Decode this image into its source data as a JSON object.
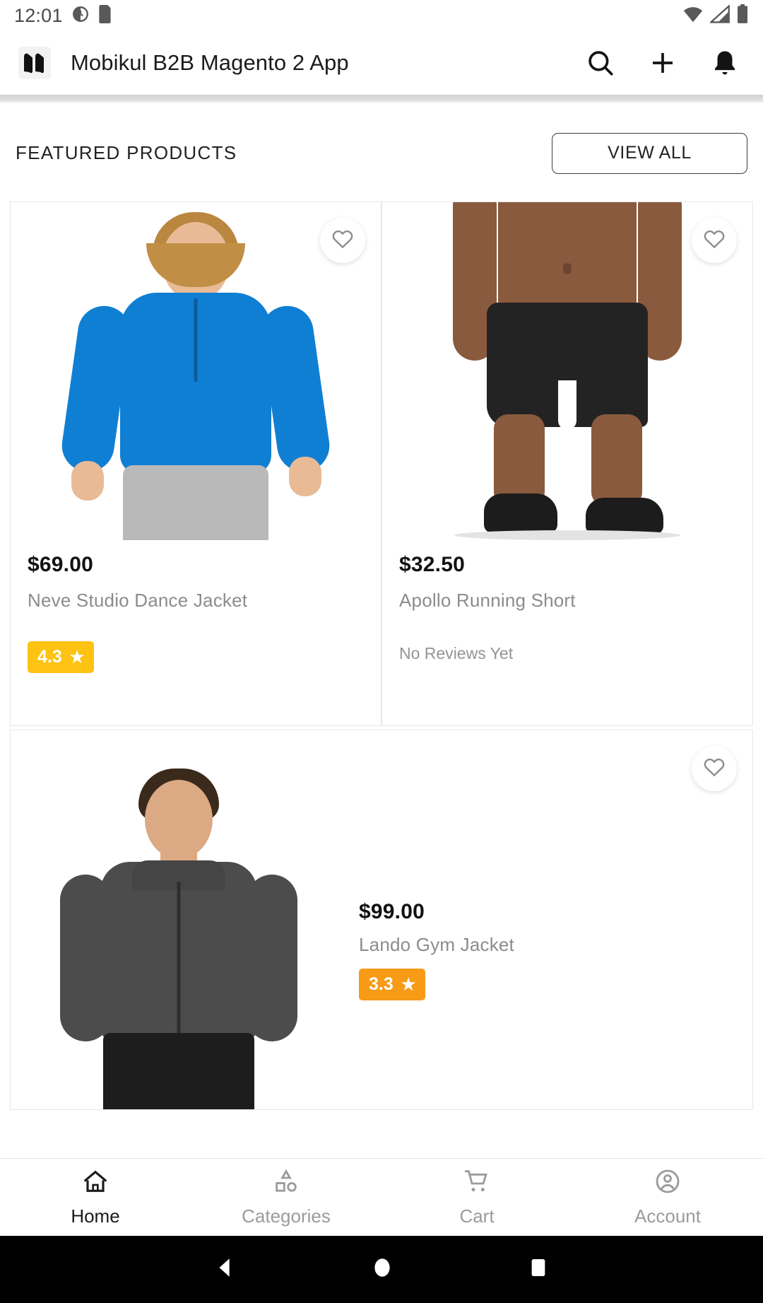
{
  "status_bar": {
    "time": "12:01",
    "left_icons": [
      "alarm-icon",
      "sd-card-icon"
    ],
    "right_icons": [
      "wifi-icon",
      "cellular-signal-icon",
      "battery-icon"
    ]
  },
  "app_bar": {
    "logo": "mobikul-logo",
    "title": "Mobikul B2B Magento 2 App",
    "actions": [
      {
        "name": "search-icon",
        "label": "Search"
      },
      {
        "name": "plus-icon",
        "label": "Add"
      },
      {
        "name": "notification-bell-icon",
        "label": "Notifications"
      }
    ]
  },
  "section": {
    "title": "FEATURED PRODUCTS",
    "view_all_label": "VIEW ALL"
  },
  "products": [
    {
      "price": "$69.00",
      "name": "Neve Studio Dance Jacket",
      "rating": "4.3",
      "rating_color": "#fdc212",
      "has_rating": true,
      "reviews_text": "",
      "wishlist_icon": "heart-outline-icon",
      "image": "woman-blue-jacket"
    },
    {
      "price": "$32.50",
      "name": "Apollo Running Short",
      "rating": "",
      "rating_color": "",
      "has_rating": false,
      "reviews_text": "No Reviews Yet",
      "wishlist_icon": "heart-outline-icon",
      "image": "man-black-shorts"
    },
    {
      "price": "$99.00",
      "name": "Lando Gym Jacket",
      "rating": "3.3",
      "rating_color": "#f79a16",
      "has_rating": true,
      "reviews_text": "",
      "wishlist_icon": "heart-outline-icon",
      "image": "man-gray-jacket"
    }
  ],
  "bottom_nav": {
    "items": [
      {
        "label": "Home",
        "icon": "home-icon",
        "active": true
      },
      {
        "label": "Categories",
        "icon": "categories-shapes-icon",
        "active": false
      },
      {
        "label": "Cart",
        "icon": "shopping-cart-icon",
        "active": false
      },
      {
        "label": "Account",
        "icon": "account-circle-icon",
        "active": false
      }
    ]
  },
  "android_nav": {
    "back": "back-triangle-icon",
    "home": "home-circle-icon",
    "recents": "recents-square-icon"
  },
  "colors": {
    "accent_blue": "#0f7fd4",
    "rating_yellow": "#fdc212",
    "rating_orange": "#f79a16",
    "text_primary": "#121212",
    "text_secondary": "#8c8c8c"
  }
}
